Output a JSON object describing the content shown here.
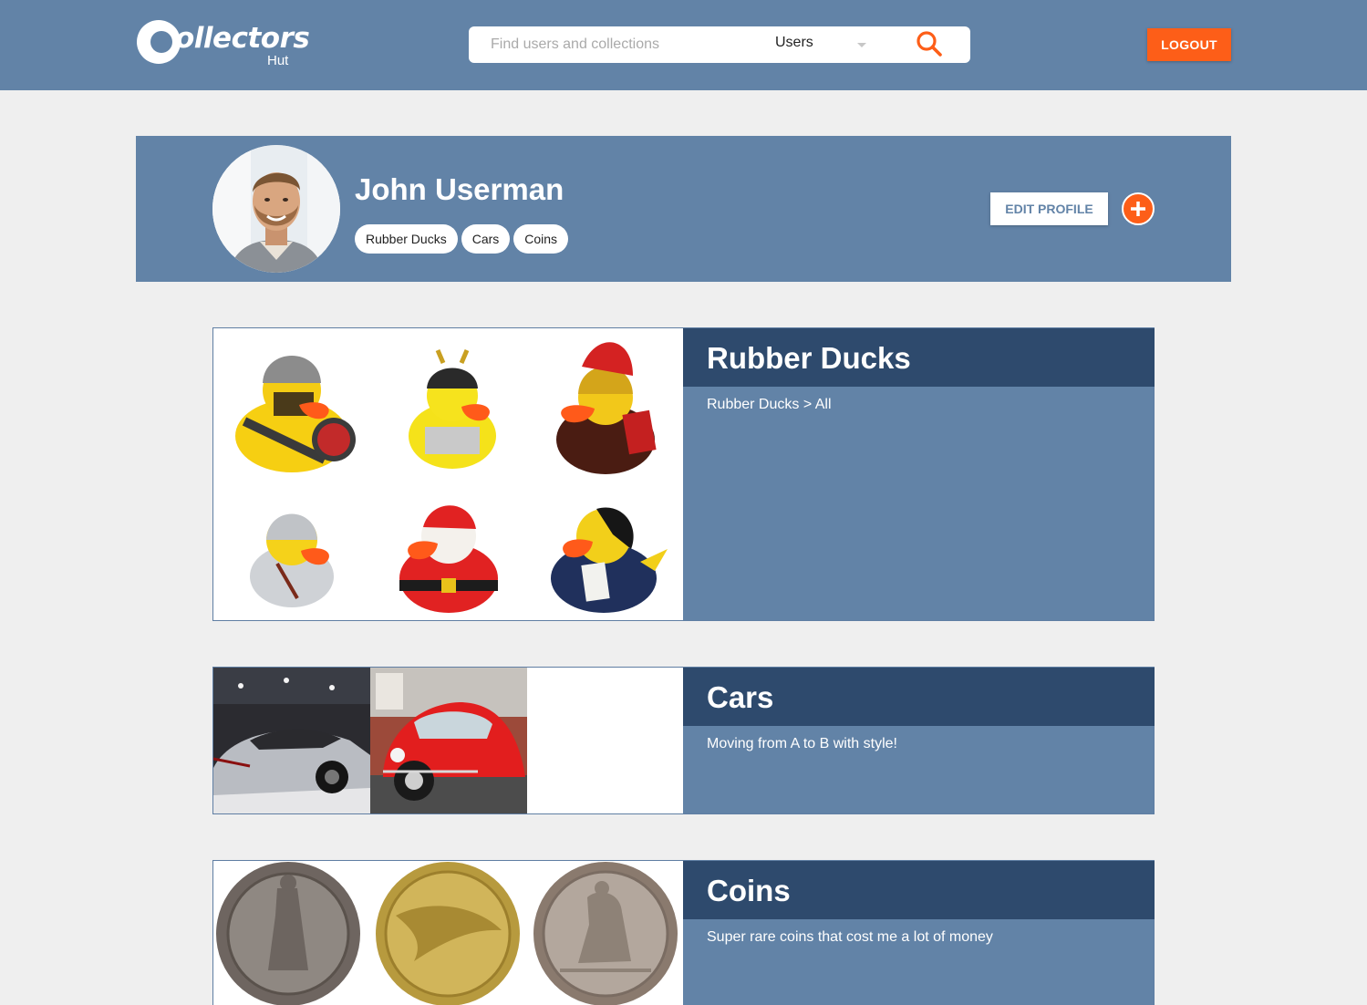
{
  "header": {
    "logo_text": "ollectors",
    "logo_sub": "Hut",
    "search": {
      "placeholder": "Find users and collections",
      "selected_option": "Users"
    },
    "logout_label": "LOGOUT"
  },
  "profile": {
    "name": "John Userman",
    "tags": [
      "Rubber Ducks",
      "Cars",
      "Coins"
    ],
    "edit_label": "EDIT PROFILE"
  },
  "collections": [
    {
      "title": "Rubber Ducks",
      "description": "Rubber Ducks > All"
    },
    {
      "title": "Cars",
      "description": "Moving from A to B with style!"
    },
    {
      "title": "Coins",
      "description": "Super rare coins that cost me a lot of money"
    }
  ],
  "colors": {
    "header_bg": "#6283a7",
    "accent": "#fd5e18",
    "card_head": "#2e4a6d",
    "page_bg": "#efefef"
  },
  "icons": {
    "search": "magnifier-icon",
    "add": "plus-icon"
  }
}
